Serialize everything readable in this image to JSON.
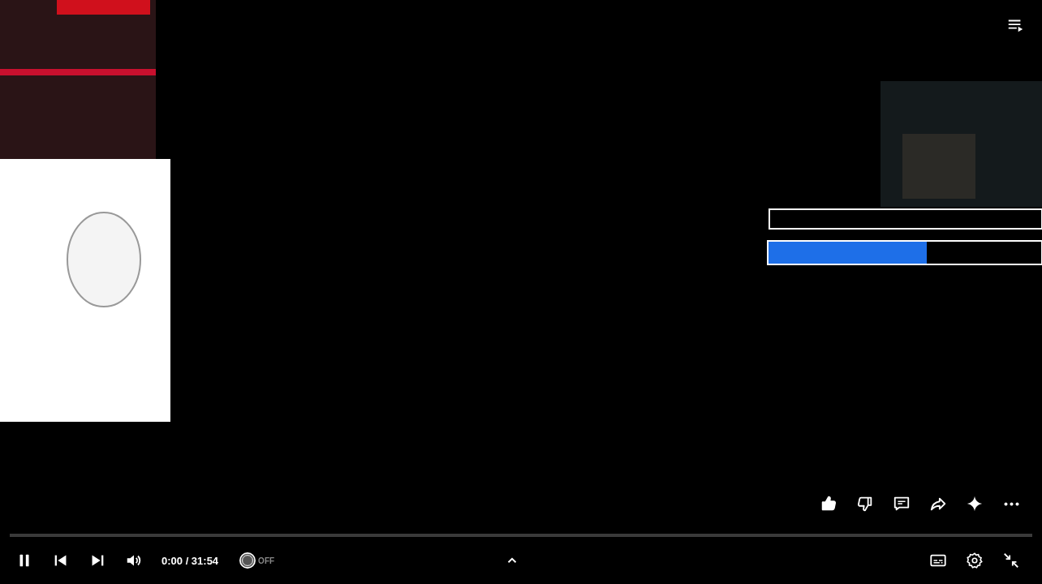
{
  "progress": {
    "level": 0
  },
  "actions": [
    {
      "kind": "like",
      "selected": true
    },
    {
      "kind": "dislike",
      "selected": false
    },
    {
      "kind": "comment"
    },
    {
      "kind": "share"
    },
    {
      "kind": "sparkle"
    },
    {
      "kind": "more"
    }
  ],
  "controls": {
    "playing": true,
    "time": "0:00 / 31:54",
    "extension": {
      "label": "OFF",
      "on": false
    }
  }
}
